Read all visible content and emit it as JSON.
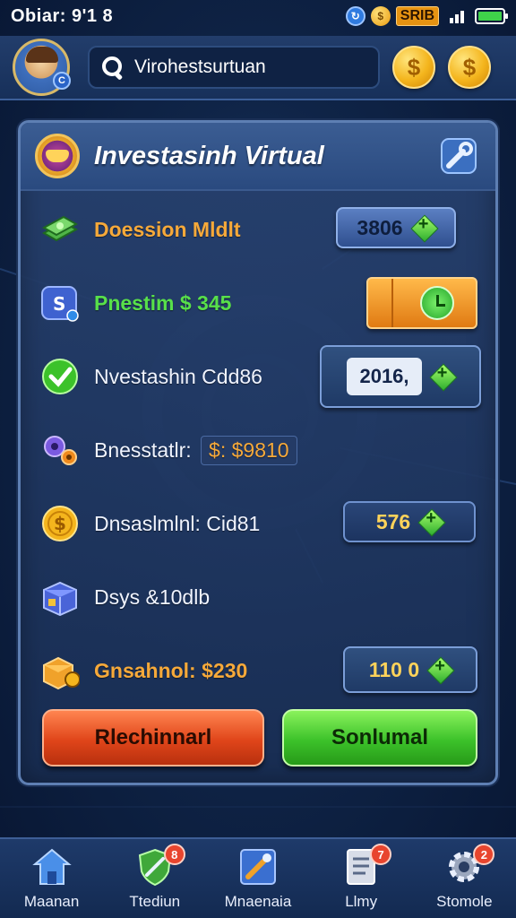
{
  "status_bar": {
    "time": "Obiar: 9'1 8",
    "indicator": "SRIB",
    "signal": "full",
    "battery": "green"
  },
  "header": {
    "search_placeholder": "Virohestsurtuan",
    "coin_symbol": "$"
  },
  "panel": {
    "title": "Investasinh Virtual",
    "rows": [
      {
        "label": "Doession Mldlt",
        "value": "3806",
        "style": "orange",
        "icon": "money-stack-icon"
      },
      {
        "label": "Pnestim $ 345",
        "value": "",
        "style": "green",
        "icon": "stats-badge-icon"
      },
      {
        "label": "Nvestashin Cdd86",
        "value": "2016,",
        "style": "white",
        "icon": "check-circle-icon"
      },
      {
        "label": "Bnesstatlr:",
        "tag": "$: $9810",
        "style": "white",
        "icon": "gears-icon"
      },
      {
        "label": "Dnsaslmlnl: Cid81",
        "value": "576",
        "style": "white",
        "icon": "gold-coin-icon"
      },
      {
        "label": "Dsys &10dlb",
        "value": "",
        "style": "white",
        "icon": "crate-icon"
      },
      {
        "label": "Gnsahnol: $230",
        "value": "110 0",
        "style": "orange",
        "icon": "treasure-box-icon"
      }
    ],
    "primary_button": "Rlechinnarl",
    "secondary_button": "Sonlumal"
  },
  "bottom_nav": [
    {
      "label": "Maanan",
      "icon": "home-icon",
      "badge": ""
    },
    {
      "label": "Ttediun",
      "icon": "shield-sword-icon",
      "badge": "8"
    },
    {
      "label": "Mnaenaia",
      "icon": "tools-icon",
      "badge": ""
    },
    {
      "label": "Llmy",
      "icon": "document-icon",
      "badge": "7"
    },
    {
      "label": "Stomole",
      "icon": "settings-gear-icon",
      "badge": "2"
    }
  ],
  "colors": {
    "accent_orange": "#f6a93a",
    "accent_green": "#58e04a",
    "panel_border": "#5e7fb3",
    "button_red": "#e0451a",
    "button_green": "#3cc22a"
  }
}
